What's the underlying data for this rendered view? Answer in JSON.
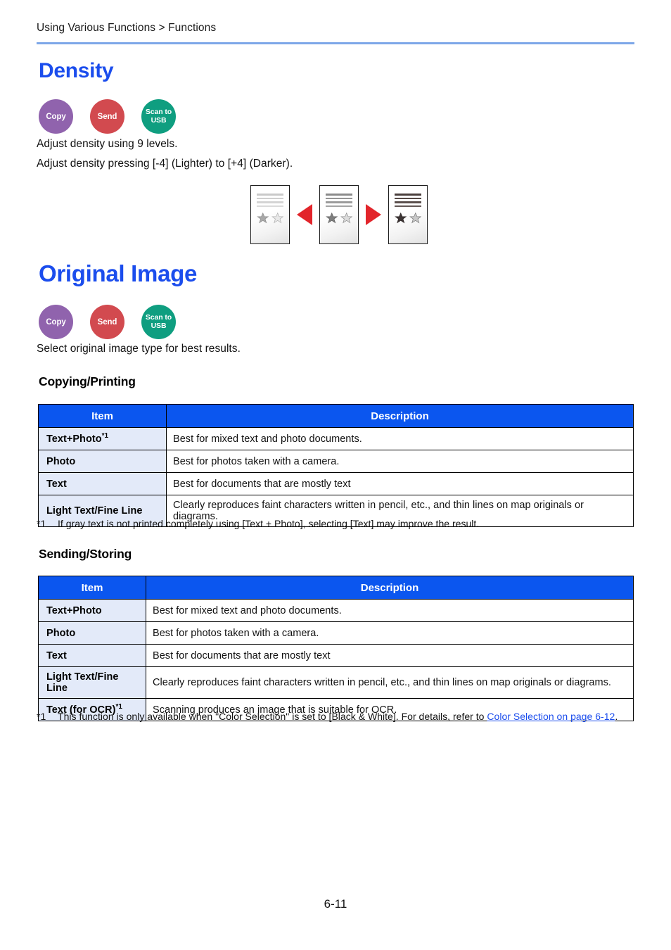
{
  "header": {
    "breadcrumb": "Using Various Functions > Functions"
  },
  "colors": {
    "heading_blue": "#1b4ded",
    "table_header_blue": "#0b56ef",
    "item_cell_blue": "#e3eaf9",
    "rule_blue": "#7da7e8",
    "badge_copy": "#9063ad",
    "badge_send": "#d24a4f",
    "badge_scan": "#0f9e80",
    "arrow_red": "#e2252b",
    "link_blue": "#1b4ded"
  },
  "sections": {
    "density": {
      "title": "Density",
      "badges": [
        {
          "label": "Copy",
          "name": "copy"
        },
        {
          "label": "Send",
          "name": "send"
        },
        {
          "label": "Scan to USB",
          "name": "scan-to-usb"
        }
      ],
      "paragraphs": [
        "Adjust density using 9 levels.",
        "Adjust density pressing [-4] (Lighter) to [+4] (Darker)."
      ],
      "figure": {
        "thumbnails": [
          {
            "level": "lighter",
            "lines": 4,
            "stars": 2
          },
          {
            "level": "normal",
            "lines": 4,
            "stars": 2
          },
          {
            "level": "darker",
            "lines": 4,
            "stars": 2
          }
        ],
        "arrows": [
          "left",
          "right"
        ]
      }
    },
    "original_image": {
      "title": "Original Image",
      "badges": [
        {
          "label": "Copy",
          "name": "copy"
        },
        {
          "label": "Send",
          "name": "send"
        },
        {
          "label": "Scan to USB",
          "name": "scan-to-usb"
        }
      ],
      "paragraph": "Select original image type for best results."
    }
  },
  "tables": {
    "copying_printing": {
      "heading": "Copying/Printing",
      "columns": [
        "Item",
        "Description"
      ],
      "rows": [
        {
          "item": "Text+Photo",
          "footnote_marker": "*1",
          "description": "Best for mixed text and photo documents."
        },
        {
          "item": "Photo",
          "footnote_marker": "",
          "description": "Best for photos taken with a camera."
        },
        {
          "item": "Text",
          "footnote_marker": "",
          "description": "Best for documents that are mostly text"
        },
        {
          "item": "Light Text/Fine Line",
          "footnote_marker": "",
          "description": "Clearly reproduces faint characters written in pencil, etc., and thin lines on map originals or diagrams."
        }
      ],
      "footnote": {
        "marker": "*1",
        "text": "If gray text is not printed completely using [Text + Photo], selecting [Text] may improve the result."
      }
    },
    "sending_storing": {
      "heading": "Sending/Storing",
      "columns": [
        "Item",
        "Description"
      ],
      "rows": [
        {
          "item": "Text+Photo",
          "footnote_marker": "",
          "description": "Best for mixed text and photo documents."
        },
        {
          "item": "Photo",
          "footnote_marker": "",
          "description": "Best for photos taken with a camera."
        },
        {
          "item": "Text",
          "footnote_marker": "",
          "description": "Best for documents that are mostly text"
        },
        {
          "item": "Light Text/Fine Line",
          "footnote_marker": "",
          "description": "Clearly reproduces faint characters written in pencil, etc., and thin lines on map originals or diagrams."
        },
        {
          "item": "Text (for OCR)",
          "footnote_marker": "*1",
          "description": "Scanning produces an image that is suitable for OCR."
        }
      ],
      "footnote": {
        "marker": "*1",
        "text_before": "This function is only available when \"Color Selection\" is set to [Black & White]. For details, refer to ",
        "link_text": "Color Selection on page 6-12",
        "text_after": "."
      }
    }
  },
  "footer": {
    "page_number": "6-11"
  }
}
